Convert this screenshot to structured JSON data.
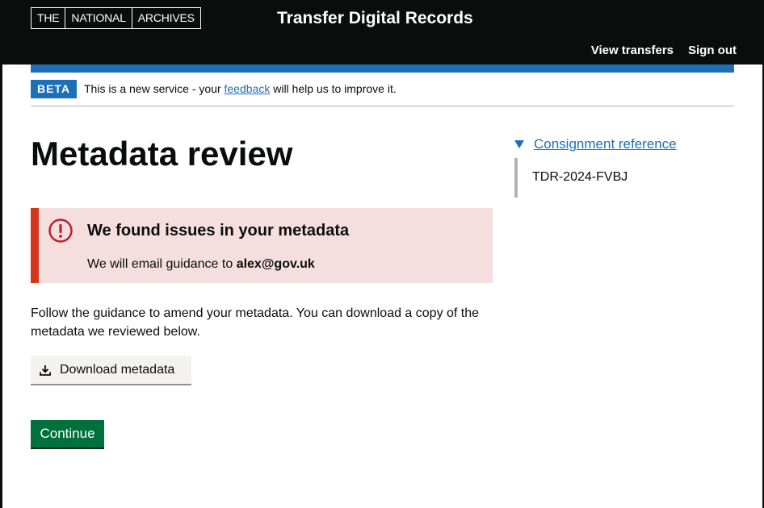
{
  "header": {
    "logo_parts": [
      "THE",
      "NATIONAL",
      "ARCHIVES"
    ],
    "service_name": "Transfer Digital Records",
    "nav": {
      "view_transfers": "View transfers",
      "sign_out": "Sign out"
    }
  },
  "phase_banner": {
    "tag": "BETA",
    "text_before": "This is a new service - your ",
    "link": "feedback",
    "text_after": " will help us to improve it."
  },
  "page": {
    "title": "Metadata review",
    "error": {
      "heading": "We found issues in your metadata",
      "body_prefix": "We will email guidance to ",
      "email": "alex@gov.uk"
    },
    "guidance": "Follow the guidance to amend your metadata. You can download a copy of the metadata we reviewed below.",
    "download_button": "Download metadata",
    "continue_button": "Continue"
  },
  "sidebar": {
    "summary": "Consignment reference",
    "reference": "TDR-2024-FVBJ"
  },
  "colors": {
    "brand_blue": "#1d70b8",
    "error_red": "#d4351c",
    "error_bg": "#f4dede",
    "success_green": "#00703c",
    "header_black": "#0b0c0c"
  },
  "icons": {
    "error": "exclamation-circle-icon",
    "download": "download-icon",
    "details": "triangle-down-icon"
  }
}
